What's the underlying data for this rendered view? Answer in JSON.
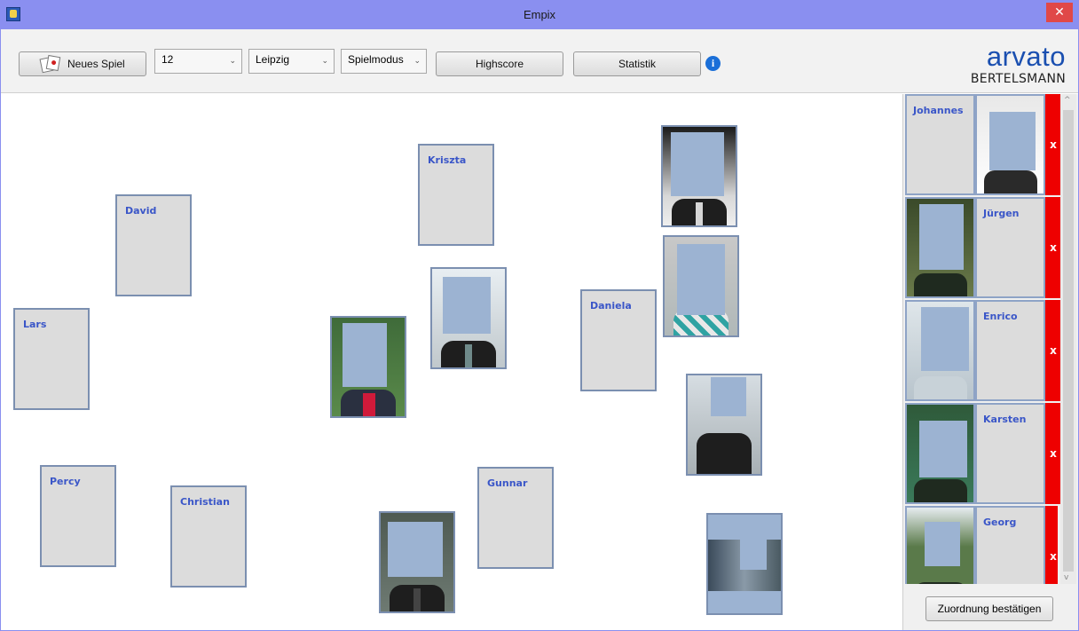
{
  "window": {
    "title": "Empix",
    "close_symbol": "✕"
  },
  "toolbar": {
    "new_game_label": "Neues Spiel",
    "count_value": "12",
    "city_value": "Leipzig",
    "mode_value": "Spielmodus",
    "highscore_label": "Highscore",
    "statistics_label": "Statistik",
    "info_symbol": "i",
    "combo_arrow": "⌄"
  },
  "logo": {
    "line1": "arvato",
    "line2": "BERTELSMANN"
  },
  "board": {
    "name_cards": [
      "Kriszta",
      "David",
      "Daniela",
      "Lars",
      "Percy",
      "Christian",
      "Gunnar"
    ],
    "photo_count": 7
  },
  "sidebar": {
    "pairs": [
      {
        "name": "Johannes",
        "remove": "x"
      },
      {
        "name": "Jürgen",
        "remove": "x"
      },
      {
        "name": "Enrico",
        "remove": "x"
      },
      {
        "name": "Karsten",
        "remove": "x"
      },
      {
        "name": "Georg",
        "remove": "x"
      }
    ],
    "confirm_label": "Zuordnung bestätigen"
  },
  "colors": {
    "titlebar": "#8a8ff0",
    "name_text": "#3a56c8",
    "remove_button": "#ee0000",
    "face_mask": "#9cb3d2",
    "logo_blue": "#1a4fb0"
  }
}
